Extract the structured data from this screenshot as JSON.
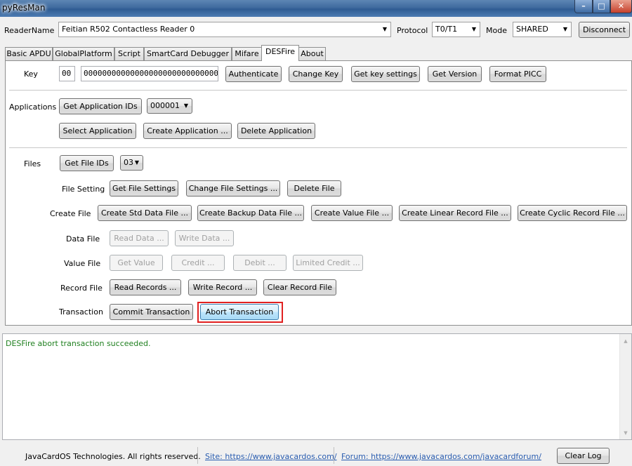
{
  "window": {
    "title": "pyResMan",
    "controls": [
      "minimize-icon",
      "maximize-icon",
      "close-icon"
    ]
  },
  "toolbar": {
    "reader_label": "ReaderName",
    "reader_value": "Feitian R502 Contactless Reader 0",
    "protocol_label": "Protocol",
    "protocol_value": "T0/T1",
    "mode_label": "Mode",
    "mode_value": "SHARED",
    "disconnect_label": "Disconnect"
  },
  "tabs": [
    {
      "label": "Basic APDU"
    },
    {
      "label": "GlobalPlatform"
    },
    {
      "label": "Script"
    },
    {
      "label": "SmartCard Debugger"
    },
    {
      "label": "Mifare"
    },
    {
      "label": "DESFire",
      "active": true
    },
    {
      "label": "About"
    }
  ],
  "desfire": {
    "key": {
      "label": "Key",
      "key_no": "00",
      "key_value": "00000000000000000000000000000000",
      "authenticate": "Authenticate",
      "change_key": "Change Key",
      "get_key_settings": "Get key settings",
      "get_version": "Get Version",
      "format_picc": "Format PICC"
    },
    "applications": {
      "label": "Applications",
      "get_ids": "Get Application IDs",
      "selected_aid": "000001",
      "select": "Select Application",
      "create": "Create Application ...",
      "delete": "Delete Application"
    },
    "files": {
      "label": "Files",
      "get_ids": "Get File IDs",
      "selected_file": "03",
      "file_setting_label": "File Setting",
      "get_settings": "Get File Settings",
      "change_settings": "Change File Settings ...",
      "delete_file": "Delete File",
      "create_file_label": "Create File",
      "create_std": "Create Std Data File ...",
      "create_backup": "Create Backup Data File ...",
      "create_value": "Create Value File ...",
      "create_linear": "Create Linear Record File ...",
      "create_cyclic": "Create Cyclic Record File ...",
      "data_file_label": "Data File",
      "read_data": "Read Data ...",
      "write_data": "Write Data ...",
      "value_file_label": "Value File",
      "get_value": "Get Value",
      "credit": "Credit ...",
      "debit": "Debit ...",
      "limited_credit": "Limited Credit ...",
      "record_file_label": "Record File",
      "read_records": "Read Records ...",
      "write_record": "Write Record ...",
      "clear_record": "Clear Record File",
      "transaction_label": "Transaction",
      "commit": "Commit Transaction",
      "abort": "Abort Transaction"
    }
  },
  "log": {
    "message": "DESFire abort transaction succeeded.",
    "message_color": "#208020"
  },
  "footer": {
    "copyright": "JavaCardOS Technologies. All rights reserved.",
    "site": "Site: https://www.javacardos.com/",
    "forum": "Forum: https://www.javacardos.com/javacardforum/",
    "clear_log": "Clear Log"
  },
  "colors": {
    "highlight": "#e02020",
    "link": "#2a5db0"
  }
}
